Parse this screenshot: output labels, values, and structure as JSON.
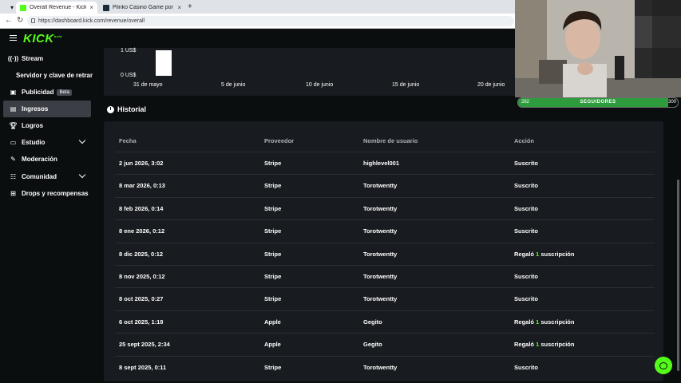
{
  "browser": {
    "tabs": [
      {
        "title": "Overall Revenue - Kick Dashboard"
      },
      {
        "title": "Plinko Casino Game por Originals"
      }
    ],
    "url": "https://dashboard.kick.com/revenue/overall"
  },
  "header": {
    "logo": "KICK"
  },
  "sidebar": {
    "items": [
      {
        "label": "Stream"
      },
      {
        "label": "Servidor y clave de retransn"
      },
      {
        "label": "Publicidad",
        "badge": "Beta"
      },
      {
        "label": "Ingresos"
      },
      {
        "label": "Logros"
      },
      {
        "label": "Estudio"
      },
      {
        "label": "Moderación"
      },
      {
        "label": "Comunidad"
      },
      {
        "label": "Drops y recompensas"
      }
    ]
  },
  "chart_data": {
    "type": "bar",
    "y_tick_labels": [
      "1 US$",
      "0 US$"
    ],
    "ylim": [
      0,
      1
    ],
    "categories": [
      "31 de mayo",
      "5 de junio",
      "10 de junio",
      "15 de junio",
      "20 de junio"
    ],
    "bars": [
      {
        "x": "2 jun",
        "value": 1
      }
    ]
  },
  "historial": {
    "title": "Historial",
    "columns": [
      "Fecha",
      "Proveedor",
      "Nombre de usuario",
      "Acción"
    ],
    "rows": [
      {
        "fecha": "2 jun 2026, 3:02",
        "proveedor": "Stripe",
        "usuario": "highlevel001",
        "accion": "Suscrito"
      },
      {
        "fecha": "8 mar 2026, 0:13",
        "proveedor": "Stripe",
        "usuario": "Torotwentty",
        "accion": "Suscrito"
      },
      {
        "fecha": "8 feb 2026, 0:14",
        "proveedor": "Stripe",
        "usuario": "Torotwentty",
        "accion": "Suscrito"
      },
      {
        "fecha": "8 ene 2026, 0:12",
        "proveedor": "Stripe",
        "usuario": "Torotwentty",
        "accion": "Suscrito"
      },
      {
        "fecha": "8 dic 2025, 0:12",
        "proveedor": "Stripe",
        "usuario": "Torotwentty",
        "accion_pre": "Regaló",
        "accion_num": "1",
        "accion_post": "suscripción"
      },
      {
        "fecha": "8 nov 2025, 0:12",
        "proveedor": "Stripe",
        "usuario": "Torotwentty",
        "accion": "Suscrito"
      },
      {
        "fecha": "8 oct 2025, 0:27",
        "proveedor": "Stripe",
        "usuario": "Torotwentty",
        "accion": "Suscrito"
      },
      {
        "fecha": "6 oct 2025, 1:18",
        "proveedor": "Apple",
        "usuario": "Gegito",
        "accion_pre": "Regaló",
        "accion_num": "1",
        "accion_post": "suscripción"
      },
      {
        "fecha": "25 sept 2025, 2:34",
        "proveedor": "Apple",
        "usuario": "Gegito",
        "accion_pre": "Regaló",
        "accion_num": "1",
        "accion_post": "suscripción"
      },
      {
        "fecha": "8 sept 2025, 0:11",
        "proveedor": "Stripe",
        "usuario": "Torotwentty",
        "accion": "Suscrito"
      }
    ]
  },
  "overlay": {
    "followers_current": "282",
    "followers_goal": "300",
    "followers_label": "SEGUIDORES",
    "progress_fraction": 0.94
  },
  "colors": {
    "accent": "#53fc18",
    "panel": "#181b1f",
    "background": "#0b0e0f"
  }
}
